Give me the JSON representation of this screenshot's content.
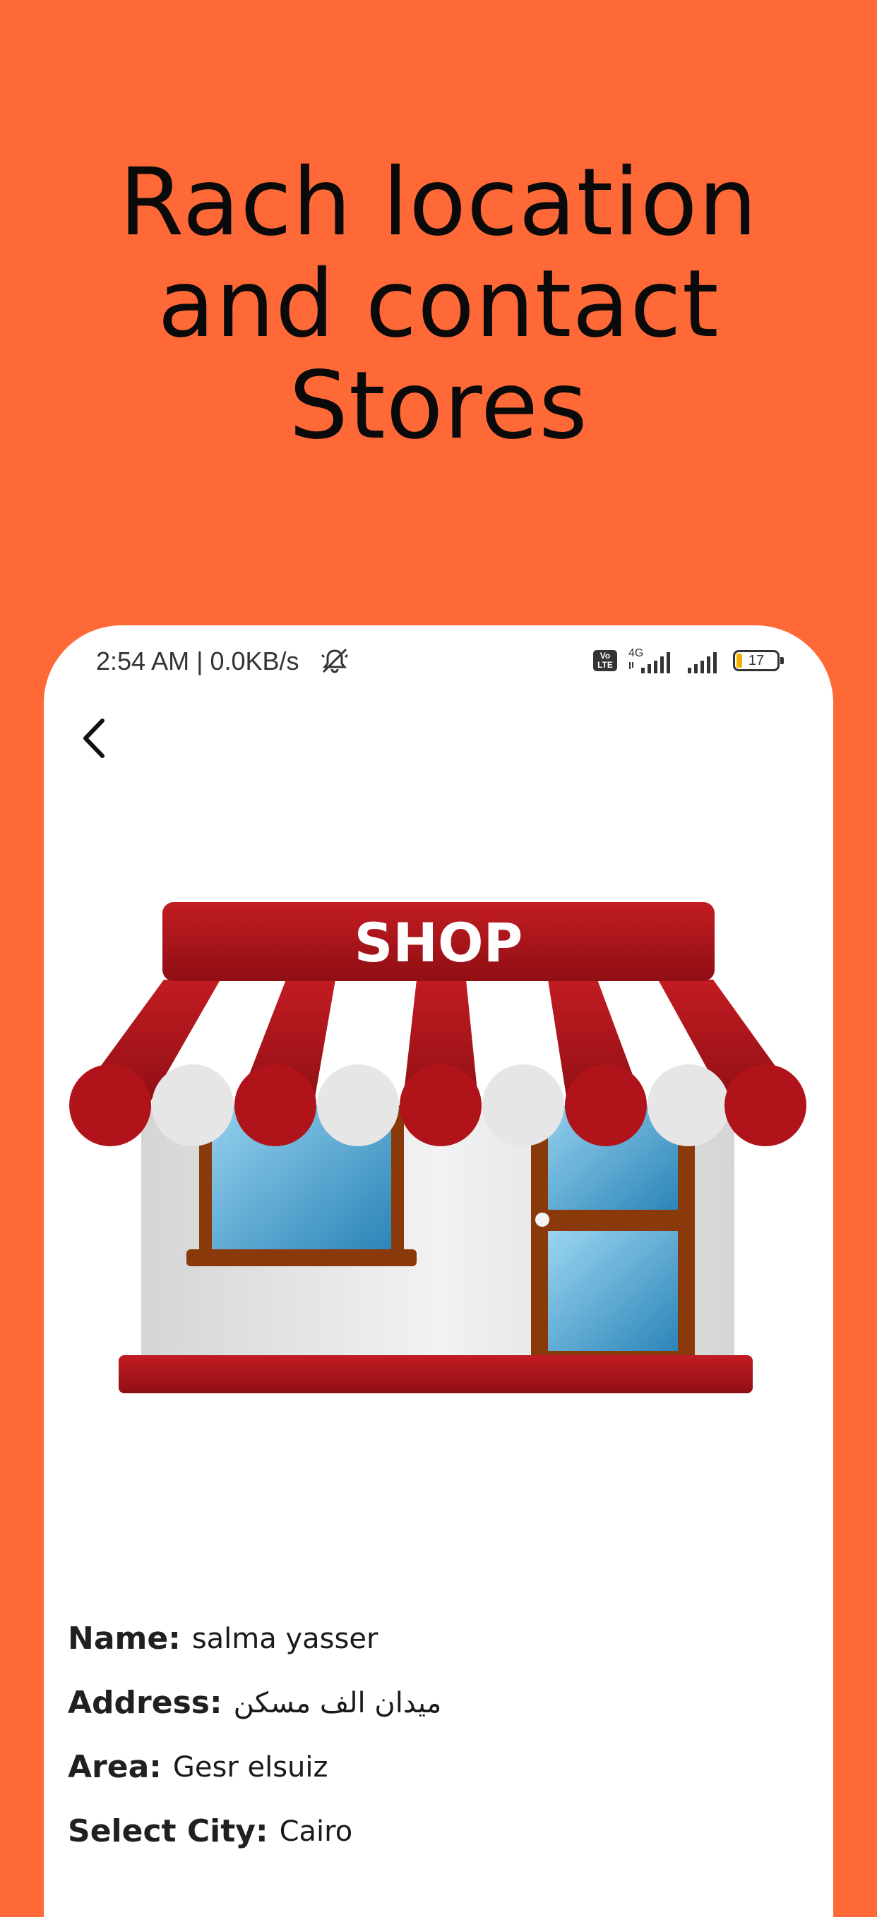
{
  "headline": {
    "line1": "Rach location",
    "line2": "and contact",
    "line3": "Stores"
  },
  "status_bar": {
    "time_and_speed": "2:54 AM | 0.0KB/s",
    "volte_label": "Vo LTE",
    "network_label": "4G",
    "battery_level": "17",
    "icons": [
      "mute-icon",
      "volte-icon",
      "signal-4g-icon",
      "signal-icon",
      "battery-icon"
    ]
  },
  "navigation": {
    "back_icon": "chevron-left-icon"
  },
  "illustration": {
    "sign_text": "SHOP",
    "awning_colors": [
      "#A8141A",
      "#ffffff"
    ]
  },
  "store_details": [
    {
      "label": "Name:",
      "value": "salma yasser"
    },
    {
      "label": "Address:",
      "value": "ميدان الف مسكن"
    },
    {
      "label": "Area:",
      "value": "Gesr elsuiz"
    },
    {
      "label": "Select City:",
      "value": "Cairo"
    }
  ],
  "colors": {
    "background": "#FF6938",
    "card": "#ffffff",
    "awning_red": "#A8141A",
    "window_blue": "#3A9BD0",
    "frame_brown": "#8A3A0A"
  }
}
